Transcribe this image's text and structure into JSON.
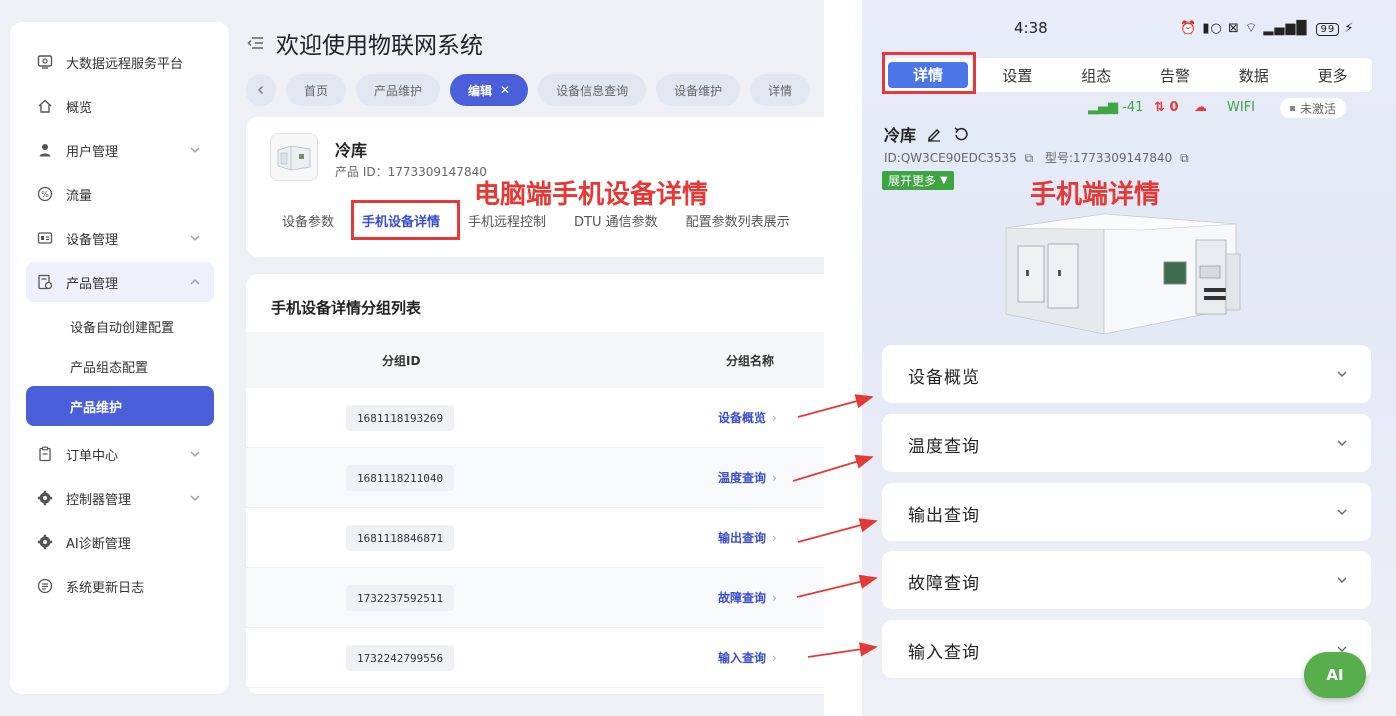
{
  "desktop": {
    "sidebar": {
      "brand": "大数据远程服务平台",
      "items": [
        {
          "label": "概览"
        },
        {
          "label": "用户管理"
        },
        {
          "label": "流量"
        },
        {
          "label": "设备管理"
        },
        {
          "label": "产品管理"
        },
        {
          "label": "订单中心"
        },
        {
          "label": "控制器管理"
        },
        {
          "label": "AI诊断管理"
        },
        {
          "label": "系统更新日志"
        }
      ],
      "submenu": [
        {
          "label": "设备自动创建配置"
        },
        {
          "label": "产品组态配置"
        },
        {
          "label": "产品维护"
        }
      ]
    },
    "header": {
      "title": "欢迎使用物联网系统"
    },
    "tabs": [
      "首页",
      "产品维护",
      "编辑",
      "设备信息查询",
      "设备维护",
      "详情"
    ],
    "product": {
      "name": "冷库",
      "id_label": "产品 ID：1773309147840",
      "tabs": [
        "设备参数",
        "手机设备详情",
        "手机远程控制",
        "DTU 通信参数",
        "配置参数列表展示"
      ]
    },
    "annotation": "电脑端手机设备详情",
    "list": {
      "title": "手机设备详情分组列表",
      "columns": [
        "分组ID",
        "分组名称"
      ],
      "rows": [
        {
          "id": "1681118193269",
          "name": "设备概览"
        },
        {
          "id": "1681118211040",
          "name": "温度查询"
        },
        {
          "id": "1681118846871",
          "name": "输出查询"
        },
        {
          "id": "1732237592511",
          "name": "故障查询"
        },
        {
          "id": "1732242799556",
          "name": "输入查询"
        }
      ]
    }
  },
  "phone": {
    "status": {
      "time": "4:38",
      "battery": "99"
    },
    "tabs": [
      "详情",
      "设置",
      "组态",
      "告警",
      "数据",
      "更多"
    ],
    "stats": {
      "signal": "-41",
      "alarms": "0",
      "network": "WIFI",
      "state": "未激活"
    },
    "device": {
      "name": "冷库",
      "id_line": "ID:QW3CE90EDC3535",
      "model_line": "型号:1773309147840",
      "expand_label": "展开更多"
    },
    "annotation": "手机端详情",
    "sections": [
      "设备概览",
      "温度查询",
      "输出查询",
      "故障查询",
      "输入查询"
    ],
    "ai_label": "AI"
  },
  "colors": {
    "accent": "#4a5fd9",
    "annotation": "#e53935",
    "phone_accent": "#4a76e8",
    "green": "#3ea542"
  }
}
